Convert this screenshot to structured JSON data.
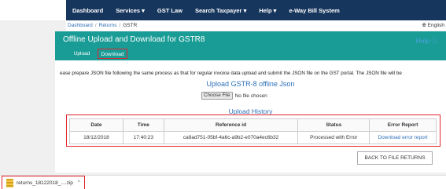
{
  "nav": {
    "items": [
      "Dashboard",
      "Services ▾",
      "GST Law",
      "Search Taxpayer ▾",
      "Help ▾",
      "e-Way Bill System"
    ]
  },
  "breadcrumb": {
    "items": [
      "Dashboard",
      "Returns",
      "GSTR"
    ],
    "language": "English"
  },
  "panel": {
    "title": "Offline Upload and Download for GSTR8",
    "help": "Help",
    "tabs": [
      "Upload",
      "Download"
    ]
  },
  "content": {
    "note": "ease prepare JSON file following the same process as that for regular invoice data upload and submit the JSON file on the GST portal. The JSON file will be",
    "upload_title": "Upload GSTR-8 offline Json",
    "choose_file_label": "Choose File",
    "no_file_text": "No file chosen",
    "history_title": "Upload History"
  },
  "table": {
    "headers": [
      "Date",
      "Time",
      "Reference id",
      "Status",
      "Error Report"
    ],
    "rows": [
      [
        "18/12/2018",
        "17:40:23",
        "ca9ad751-05bf-4a6c-a9b2-e070a4ec6b32",
        "Processed with Error",
        "Download error report"
      ]
    ]
  },
  "back_button": "BACK TO FILE RETURNS",
  "download_bar": {
    "file_name": "returns_18122018_....zip"
  },
  "colors": {
    "nav": "#17365d",
    "header": "#1a9c96",
    "highlight": "#e0232b",
    "link": "#2d70b8"
  }
}
